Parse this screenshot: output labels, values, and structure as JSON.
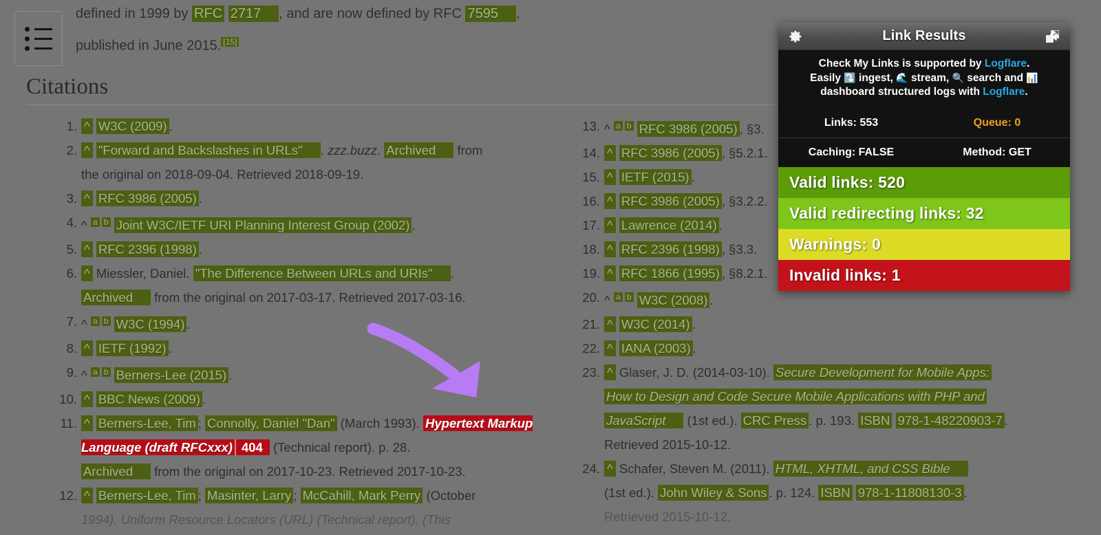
{
  "page": {
    "lead_line1_pre": "defined in 1999 by ",
    "lead_rfc_label": "RFC",
    "lead_rfc_num": "2717",
    "lead_mid": ", and are now defined by RFC ",
    "lead_rfc_num2": "7595",
    "lead_tail": ",",
    "lead_line2": "published in June 2015.",
    "lead_ref": "[15]",
    "heading": "Citations",
    "toc_icon": "list-icon"
  },
  "citations_left": [
    {
      "n": "1.",
      "caret": "^",
      "parts": "W3C (2009)."
    },
    {
      "n": "2.",
      "caret": "^",
      "parts": "\"Forward and Backslashes in URLs\" . zzz.buzz. Archived from the original on 2018-09-04. Retrieved 2018-09-19."
    },
    {
      "n": "3.",
      "caret": "^",
      "parts": "RFC 3986 (2005)."
    },
    {
      "n": "4.",
      "caret": "^ a b",
      "parts": "Joint W3C/IETF URI Planning Interest Group (2002)."
    },
    {
      "n": "5.",
      "caret": "^",
      "parts": "RFC 2396 (1998)."
    },
    {
      "n": "6.",
      "caret": "^",
      "parts": "Miessler, Daniel. \"The Difference Between URLs and URIs\" . Archived from the original on 2017-03-17. Retrieved 2017-03-16."
    },
    {
      "n": "7.",
      "caret": "^ a b",
      "parts": "W3C (1994)."
    },
    {
      "n": "8.",
      "caret": "^",
      "parts": "IETF (1992)."
    },
    {
      "n": "9.",
      "caret": "^ a b",
      "parts": "Berners-Lee (2015)."
    },
    {
      "n": "10.",
      "caret": "^",
      "parts": "BBC News (2009)."
    },
    {
      "n": "11.",
      "caret": "^",
      "parts": "Berners-Lee, Tim; Connolly, Daniel \"Dan\" (March 1993). Hypertext Markup Language (draft RFCxxx) 404 (Technical report). p. 28. Archived from the original on 2017-10-23. Retrieved 2017-10-23."
    },
    {
      "n": "12.",
      "caret": "^",
      "parts": "Berners-Lee, Tim; Masinter, Larry; McCahill, Mark Perry (October 1994). Uniform Resource Locators (URL) (Technical report). (This"
    }
  ],
  "cite_text": {
    "c1_link": "W3C (2009)",
    "c2_link": "\"Forward and Backslashes in URLs\"",
    "c2_mid": ". ",
    "c2_site": "zzz.buzz",
    "c2_dot": ". ",
    "c2_archived": "Archived",
    "c2_rest": " from",
    "c2_line2": "the original on 2018-09-04. Retrieved 2018-09-19.",
    "c3_link": "RFC 3986 (2005)",
    "c4_link": "Joint W3C/IETF URI Planning Interest Group (2002)",
    "c5_link": "RFC 2396 (1998)",
    "c6_author": "Miessler, Daniel. ",
    "c6_link": "\"The Difference Between URLs and URIs\"",
    "c6_archived": "Archived",
    "c6_rest": " from the original on 2017-03-17. Retrieved 2017-03-16.",
    "c7_link": "W3C (1994)",
    "c8_link": "IETF (1992)",
    "c9_link": "Berners-Lee (2015)",
    "c10_link": "BBC News (2009)",
    "c11_a1": "Berners-Lee, Tim",
    "c11_semi": "; ",
    "c11_a2": "Connolly, Daniel \"Dan\"",
    "c11_date": " (March 1993). ",
    "c11_bad_title": "Hypertext Markup Language (draft RFCxxx)",
    "c11_bad_code": "404",
    "c11_rest": " (Technical report). p. 28.",
    "c11_archived": "Archived",
    "c11_rest2": " from the original on 2017-10-23. Retrieved 2017-10-23.",
    "c12_a1": "Berners-Lee, Tim",
    "c12_a2": "Masinter, Larry",
    "c12_a3": "McCahill, Mark Perry",
    "c12_date": " (October",
    "c12_line2": "1994). Uniform Resource Locators (URL) (Technical report). (This",
    "c13_link": "RFC 3986 (2005)",
    "c13_sec": ", §3.",
    "c14_link": "RFC 3986 (2005)",
    "c14_sec": ", §5.2.1.",
    "c15_link": "IETF (2015)",
    "c16_link": "RFC 3986 (2005)",
    "c16_sec": ", §3.2.2.",
    "c17_link": "Lawrence (2014)",
    "c18_link": "RFC 2396 (1998)",
    "c18_sec": ", §3.3.",
    "c19_link": "RFC 1866 (1995)",
    "c19_sec": ", §8.2.1.",
    "c20_link": "W3C (2008)",
    "c21_link": "W3C (2014)",
    "c22_link": "IANA (2003)",
    "c23_author": "Glaser, J. D. (2014-03-10). ",
    "c23_title1": "Secure Development for Mobile Apps:",
    "c23_title2": "How to Design and Code Secure Mobile Applications with PHP and",
    "c23_title3": "JavaScript",
    "c23_ed": " (1st ed.). ",
    "c23_pub": "CRC Press",
    "c23_page": ". p. 193. ",
    "c23_isbn_label": "ISBN",
    "c23_isbn": "978-1-48220903-7",
    "c23_dot": ".",
    "c23_retr": "Retrieved 2015-10-12.",
    "c24_author": "Schafer, Steven M. (2011). ",
    "c24_title": "HTML, XHTML, and CSS Bible",
    "c24_ed": "(1st ed.). ",
    "c24_pub": "John Wiley & Sons",
    "c24_page": ". p. 124. ",
    "c24_isbn_label": "ISBN",
    "c24_isbn": "978-1-11808130-3",
    "c24_dot": ".",
    "c24_retr": "Retrieved 2015-10-12."
  },
  "numbers": {
    "n1": "1.",
    "n2": "2.",
    "n3": "3.",
    "n4": "4.",
    "n5": "5.",
    "n6": "6.",
    "n7": "7.",
    "n8": "8.",
    "n9": "9.",
    "n10": "10.",
    "n11": "11.",
    "n12": "12.",
    "n13": "13.",
    "n14": "14.",
    "n15": "15.",
    "n16": "16.",
    "n17": "17.",
    "n18": "18.",
    "n19": "19.",
    "n20": "20.",
    "n21": "21.",
    "n22": "22.",
    "n23": "23.",
    "n24": "24."
  },
  "carets": {
    "single": "^",
    "a": "a",
    "b": "b",
    "hat": "^"
  },
  "panel": {
    "title": "Link Results",
    "gear_icon": "gear-icon",
    "popout_icon": "popout-icon",
    "close_icon": "close-icon",
    "close_label": "×",
    "promo": {
      "line1_pre": "Check My Links is supported by ",
      "brand1": "Logflare",
      "line1_post": ".",
      "line2_pre": "Easily ",
      "emoji_ingest": "⤵️",
      "line2_a": " ingest, ",
      "emoji_stream": "🌊",
      "line2_b": " stream, ",
      "emoji_search": "🔍",
      "line2_c": " search and ",
      "emoji_chart": "📊",
      "line3_pre": "dashboard structured logs with ",
      "brand2": "Logflare",
      "line3_post": "."
    },
    "stats": {
      "links_label": "Links: 553",
      "queue_label": "Queue: 0",
      "caching_label": "Caching: FALSE",
      "method_label": "Method: GET"
    },
    "results": [
      {
        "label": "Valid links: 520",
        "color": "#5d9c09"
      },
      {
        "label": "Valid redirecting links: 32",
        "color": "#7ec61a"
      },
      {
        "label": "Warnings: 0",
        "color": "#dbdb25"
      },
      {
        "label": "Invalid links: 1",
        "color": "#c4121a"
      }
    ],
    "result_valid": "Valid links: 520",
    "result_redirect": "Valid redirecting links: 32",
    "result_warn": "Warnings: 0",
    "result_invalid": "Invalid links: 1"
  },
  "annotation": {
    "arrow_color": "#b77cf5",
    "arrow_name": "purple-arrow-annotation"
  }
}
